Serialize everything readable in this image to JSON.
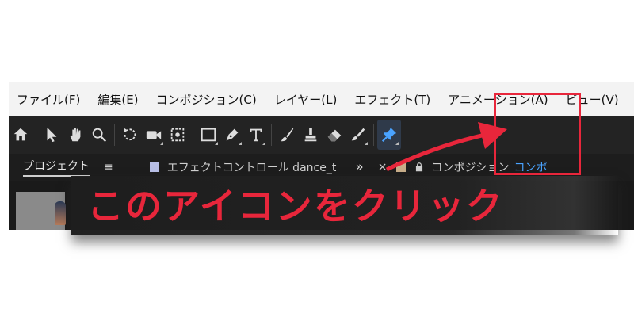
{
  "menubar": {
    "items": [
      "ファイル(F)",
      "編集(E)",
      "コンポジション(C)",
      "レイヤー(L)",
      "エフェクト(T)",
      "アニメーション(A)",
      "ビュー(V)"
    ]
  },
  "toolbar": {
    "tools": [
      "home-icon",
      "selection-arrow-icon",
      "hand-icon",
      "zoom-icon",
      "rotate-icon",
      "camera-icon",
      "pan-behind-icon",
      "rectangle-icon",
      "pen-icon",
      "type-icon",
      "brush-icon",
      "clone-stamp-icon",
      "eraser-icon",
      "roto-brush-icon",
      "puppet-pin-icon"
    ],
    "active_tool": "puppet-pin-icon",
    "active_color": "#4aa3ff"
  },
  "tabs": {
    "project": "プロジェクト",
    "project_menu": "≡",
    "effect_controls": "エフェクトコントロール dance_t",
    "overflow": "»",
    "close": "×",
    "composition": "コンポジション",
    "composition_name": "コンポ",
    "swatch_effect": "#b8bfe6",
    "swatch_comp": "#c8ae8a"
  },
  "annotation": {
    "text": "このアイコンをクリック",
    "color": "#e8263b"
  }
}
